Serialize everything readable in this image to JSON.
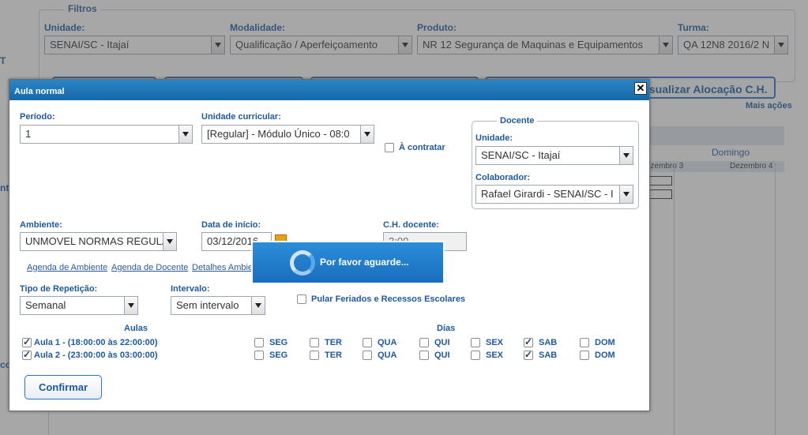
{
  "background": {
    "filters_legend": "Filtros",
    "filters": [
      {
        "label": "Unidade:",
        "value": "SENAI/SC - Itajaí"
      },
      {
        "label": "Modalidade:",
        "value": "Qualificação / Aperfeiçoamento"
      },
      {
        "label": "Produto:",
        "value": "NR 12 Segurança de Maquinas e Equipamentos"
      },
      {
        "label": "Turma:",
        "value": "QA 12N8 2016/2 N"
      }
    ],
    "visualizar_button": "isualizar Alocação C.H.",
    "mais_acoes": "Mais ações",
    "calendar": {
      "day_name": "Domingo",
      "dates": [
        "ezembro 3",
        "Dezembro 4"
      ]
    },
    "side_letters": [
      "T",
      "nt",
      "co"
    ]
  },
  "dialog": {
    "title": "Aula normal",
    "close_icon": "close-icon",
    "periodo": {
      "label": "Período:",
      "value": "1"
    },
    "unidade_curricular": {
      "label": "Unidade curricular:",
      "value": "[Regular] - Módulo Único - 08:0"
    },
    "a_contratar": "À contratar",
    "docente": {
      "legend": "Docente",
      "unidade_label": "Unidade:",
      "unidade_value": "SENAI/SC - Itajaí",
      "colaborador_label": "Colaborador:",
      "colaborador_value": "Rafael Girardi - SENAI/SC - I"
    },
    "ambiente": {
      "label": "Ambiente:",
      "value": "UNMOVEL NORMAS REGULAI"
    },
    "data_inicio": {
      "label": "Data de início:",
      "value": "03/12/2016"
    },
    "ch_docente": {
      "label": "C.H. docente:",
      "value": "3:00"
    },
    "links": [
      "Agenda de Ambiente",
      "Agenda de Docente",
      "Detalhes Ambie"
    ],
    "tipo_repeticao": {
      "label": "Tipo de Repetição:",
      "value": "Semanal"
    },
    "intervalo": {
      "label": "Intervalo:",
      "value": "Sem intervalo"
    },
    "pular_feriados": "Pular Feriados e Recessos Escolares",
    "aulas_header": "Aulas",
    "dias_header": "Dias",
    "aulas": [
      {
        "label": "Aula 1 - (18:00:00  às  22:00:00)",
        "checked": true
      },
      {
        "label": "Aula 2 - (23:00:00  às  03:00:00)",
        "checked": true
      }
    ],
    "days": [
      "SEG",
      "TER",
      "QUA",
      "QUI",
      "SEX",
      "SAB",
      "DOM"
    ],
    "day_checks": [
      [
        false,
        false,
        false,
        false,
        false,
        true,
        false
      ],
      [
        false,
        false,
        false,
        false,
        false,
        true,
        false
      ]
    ],
    "confirm_button": "Confirmar"
  },
  "wait": {
    "text": "Por favor aguarde..."
  }
}
